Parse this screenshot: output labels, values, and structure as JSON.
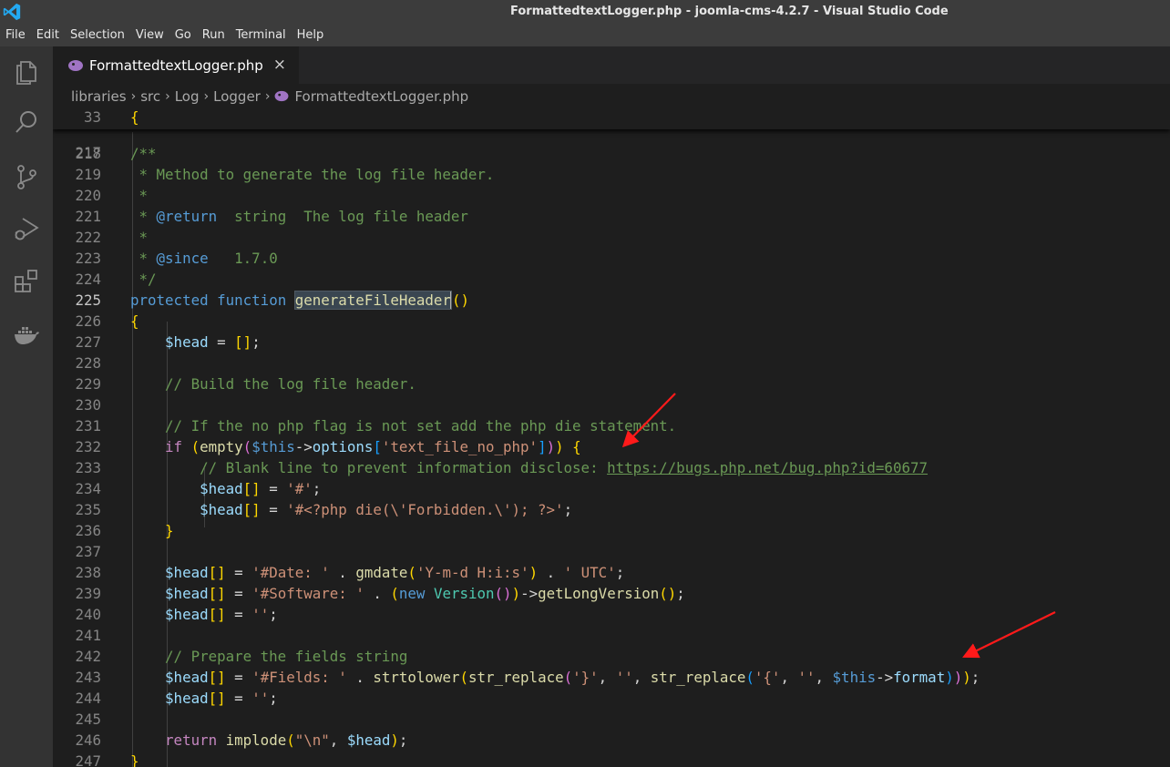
{
  "window": {
    "title": "FormattedtextLogger.php - joomla-cms-4.2.7 - Visual Studio Code"
  },
  "menu": [
    "File",
    "Edit",
    "Selection",
    "View",
    "Go",
    "Run",
    "Terminal",
    "Help"
  ],
  "activity_bar": [
    "explorer-icon",
    "search-icon",
    "source-control-icon",
    "run-debug-icon",
    "extensions-icon",
    "docker-icon"
  ],
  "tab": {
    "label": "FormattedtextLogger.php",
    "close": "×"
  },
  "breadcrumb": [
    "libraries",
    "src",
    "Log",
    "Logger",
    "FormattedtextLogger.php"
  ],
  "editor": {
    "sticky_line": {
      "number": "33",
      "text": "{"
    },
    "partial_line_number": "217",
    "active_line": "225",
    "lines": [
      {
        "n": "218",
        "text": "    /**"
      },
      {
        "n": "219",
        "text": "     * Method to generate the log file header."
      },
      {
        "n": "220",
        "text": "     *"
      },
      {
        "n": "221",
        "text": "     * @return  string  The log file header"
      },
      {
        "n": "222",
        "text": "     *"
      },
      {
        "n": "223",
        "text": "     * @since   1.7.0"
      },
      {
        "n": "224",
        "text": "     */"
      },
      {
        "n": "225",
        "text": "    protected function generateFileHeader()"
      },
      {
        "n": "226",
        "text": "    {"
      },
      {
        "n": "227",
        "text": "        $head = [];"
      },
      {
        "n": "228",
        "text": ""
      },
      {
        "n": "229",
        "text": "        // Build the log file header."
      },
      {
        "n": "230",
        "text": ""
      },
      {
        "n": "231",
        "text": "        // If the no php flag is not set add the php die statement."
      },
      {
        "n": "232",
        "text": "        if (empty($this->options['text_file_no_php'])) {"
      },
      {
        "n": "233",
        "text": "            // Blank line to prevent information disclose: https://bugs.php.net/bug.php?id=60677"
      },
      {
        "n": "234",
        "text": "            $head[] = '#';"
      },
      {
        "n": "235",
        "text": "            $head[] = '#<?php die(\\'Forbidden.\\'); ?>';"
      },
      {
        "n": "236",
        "text": "        }"
      },
      {
        "n": "237",
        "text": ""
      },
      {
        "n": "238",
        "text": "        $head[] = '#Date: ' . gmdate('Y-m-d H:i:s') . ' UTC';"
      },
      {
        "n": "239",
        "text": "        $head[] = '#Software: ' . (new Version())->getLongVersion();"
      },
      {
        "n": "240",
        "text": "        $head[] = '';"
      },
      {
        "n": "241",
        "text": ""
      },
      {
        "n": "242",
        "text": "        // Prepare the fields string"
      },
      {
        "n": "243",
        "text": "        $head[] = '#Fields: ' . strtolower(str_replace('}', '', str_replace('{', '', $this->format)));"
      },
      {
        "n": "244",
        "text": "        $head[] = '';"
      },
      {
        "n": "245",
        "text": ""
      },
      {
        "n": "246",
        "text": "        return implode(\"\\n\", $head);"
      },
      {
        "n": "247",
        "text": "    }"
      }
    ]
  },
  "colors": {
    "keyword": "#569cd6",
    "control": "#c586c0",
    "function": "#dcdcaa",
    "variable": "#9cdcfe",
    "string": "#ce9178",
    "comment": "#6a9955",
    "annotation_arrow": "#ff1a1a"
  }
}
